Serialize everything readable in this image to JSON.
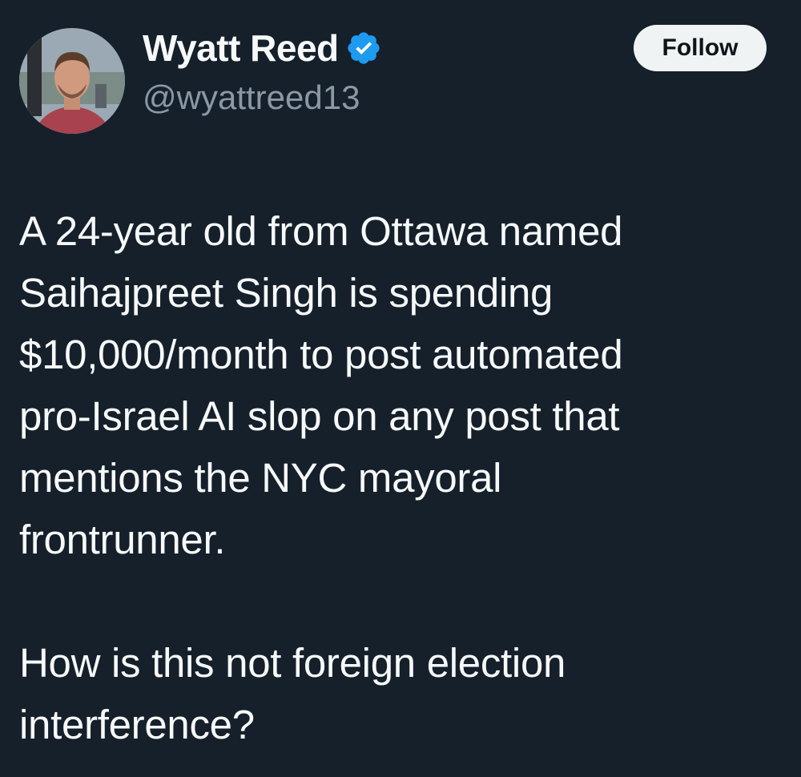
{
  "author": {
    "display_name": "Wyatt Reed",
    "handle": "@wyattreed13",
    "verified": true,
    "avatar_icon": "profile-photo"
  },
  "follow_button": {
    "label": "Follow"
  },
  "tweet": {
    "paragraph_1": "A 24-year old from Ottawa named\nSaihajpreet Singh is spending\n$10,000/month to post automated\npro-Israel AI slop on any post that\nmentions the NYC mayoral\nfrontrunner.",
    "paragraph_2": "How is this not foreign election\ninterference?"
  },
  "colors": {
    "background": "#15202b",
    "text_primary": "#f7f9f9",
    "text_secondary": "#8b98a5",
    "verified_blue": "#1d9bf0",
    "follow_bg": "#eff3f4"
  }
}
